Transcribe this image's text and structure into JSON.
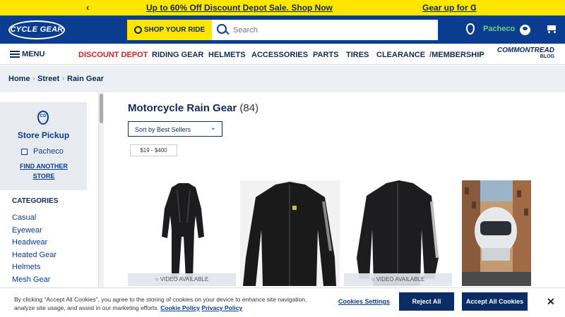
{
  "promo": {
    "message": "Up to 60% Off Discount Depot Sale. Shop Now",
    "next_message": "Gear up for C",
    "prev_icon": "chevron-left-icon",
    "next_icon": "chevron-right-icon"
  },
  "header": {
    "logo_text": "CYCLE GEAR",
    "shop_label": "SHOP YOUR RIDE",
    "search_placeholder": "Search",
    "store_name": "Pacheco",
    "colors": {
      "brand_blue": "#0a3d8f",
      "accent_yellow": "#ffe600",
      "store_green": "#6cd67b"
    }
  },
  "nav": {
    "menu_label": "MENU",
    "items": [
      "DISCOUNT DEPOT",
      "RIDING GEAR",
      "HELMETS",
      "ACCESSORIES",
      "PARTS",
      "TIRES",
      "CLEARANCE",
      "MEMBERSHIP"
    ],
    "commontread": "COMMONTREAD",
    "commontread_sub": "BLOG"
  },
  "breadcrumb": [
    "Home",
    "Street",
    "Rain Gear"
  ],
  "sidebar": {
    "store_pickup_title": "Store Pickup",
    "store_option": "Pacheco",
    "find_store": "FIND ANOTHER STORE",
    "categories_title": "CATEGORIES",
    "categories": [
      "Casual",
      "Eyewear",
      "Headwear",
      "Heated Gear",
      "Helmets",
      "Mesh Gear"
    ]
  },
  "main": {
    "title": "Motorcycle Rain Gear",
    "count": "(84)",
    "sort_value": "Sort by Best Sellers",
    "price_filter": "$19 - $400",
    "products": [
      {
        "image": "black rain suit",
        "badge": "VIDEO AVAILABLE"
      },
      {
        "image": "black rain jacket",
        "badge": ""
      },
      {
        "image": "black rain jacket with reflective stripes",
        "badge": "VIDEO AVAILABLE"
      },
      {
        "image": "white helmet city street",
        "badge": ""
      }
    ]
  },
  "cookie": {
    "text": "By clicking “Accept All Cookies”, you agree to the storing of cookies on your device to enhance site navigation, analyze site usage, and assist in our marketing efforts.",
    "policy_link": "Cookie Policy",
    "privacy_link": "Privacy Policy",
    "settings": "Cookies Settings",
    "reject": "Reject All",
    "accept": "Accept All Cookies"
  }
}
